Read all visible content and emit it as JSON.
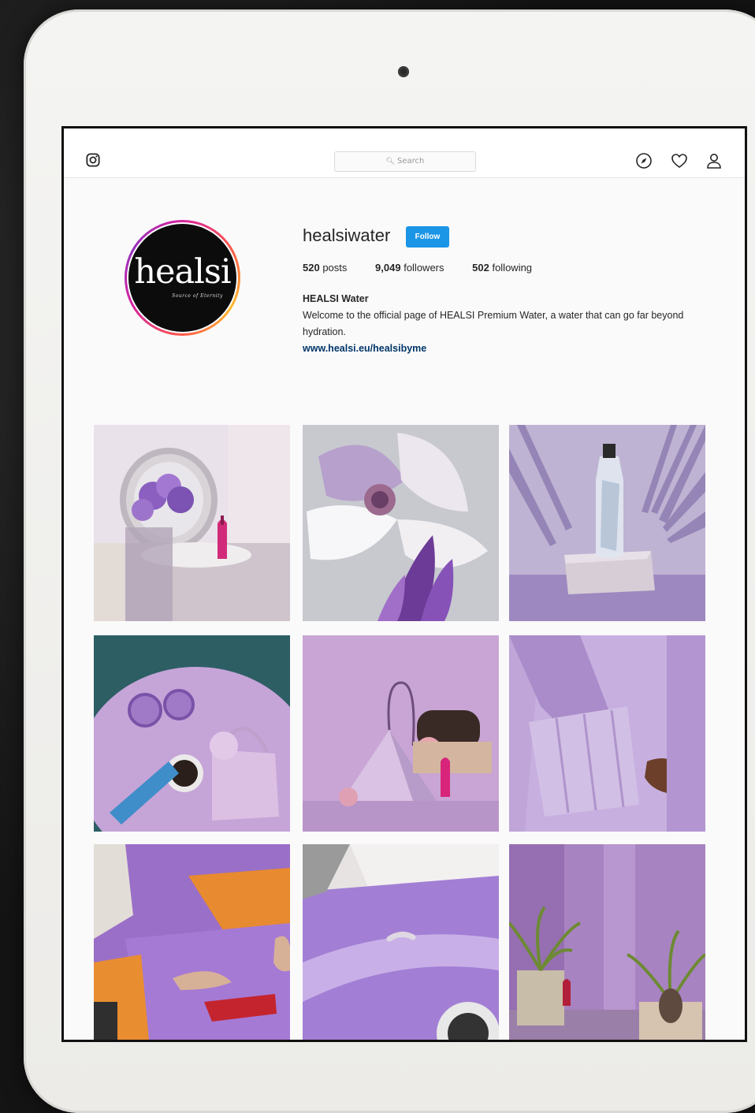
{
  "nav": {
    "search_placeholder": "Search",
    "icons": [
      "instagram-logo-icon",
      "compass-icon",
      "heart-icon",
      "person-icon"
    ]
  },
  "profile": {
    "avatar_brand": "healsi",
    "avatar_tagline": "Source of Eternity",
    "username": "healsiwater",
    "follow_label": "Follow",
    "posts_count": "520",
    "posts_label": "posts",
    "followers_count": "9,049",
    "followers_label": "followers",
    "following_count": "502",
    "following_label": "following",
    "bio_name": "HEALSI Water",
    "bio_text": "Welcome to the official page of HEALSI Premium Water, a water that can go far beyond hydration.",
    "bio_link": "www.healsi.eu/healsibyme"
  },
  "colors": {
    "follow_button": "#1b95e6",
    "link": "#003569",
    "accent_lavender": "#b79ad8"
  },
  "posts": [
    {
      "subject": "vanity-mirror-lilac-flowers-bottle"
    },
    {
      "subject": "magnolia-flower"
    },
    {
      "subject": "bottle-on-stone-palm-shadow"
    },
    {
      "subject": "table-glasses-handbag-bottle"
    },
    {
      "subject": "origami-bag-woman-bottle"
    },
    {
      "subject": "lilac-outfit-handbag"
    },
    {
      "subject": "woman-lilac-dress-orange-chair"
    },
    {
      "subject": "lilac-vintage-car"
    },
    {
      "subject": "palm-plants-lilac-wall"
    }
  ]
}
